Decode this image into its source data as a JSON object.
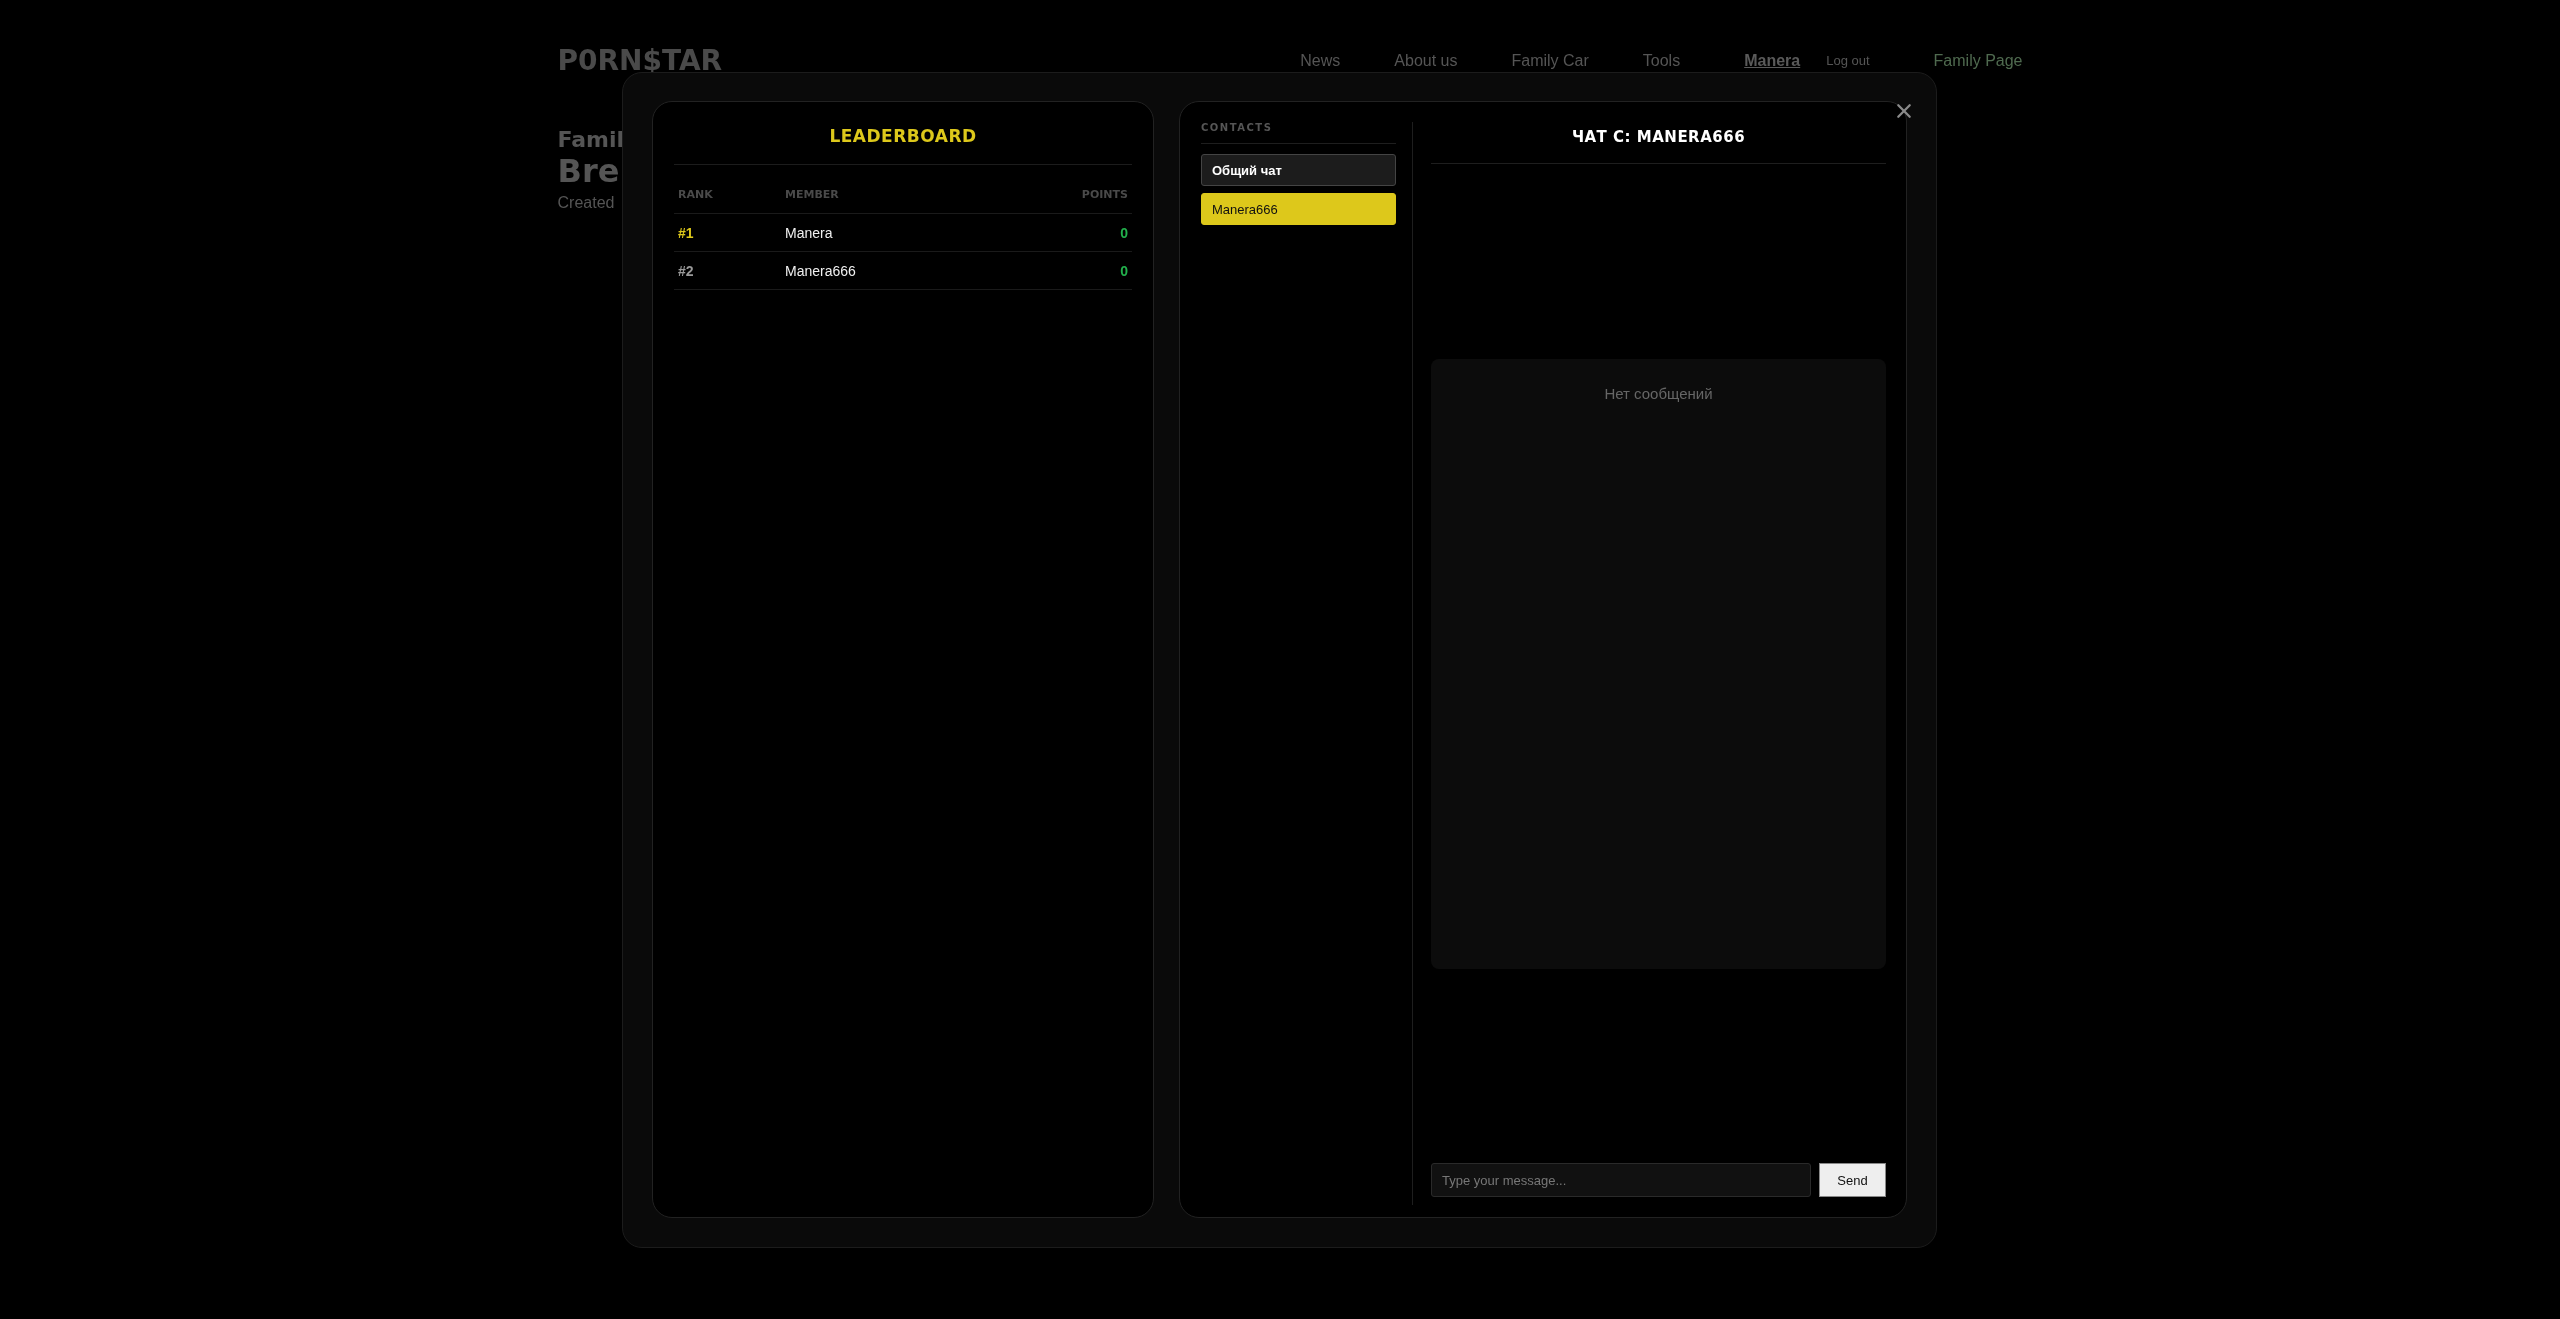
{
  "site": {
    "logo": "P0RN$TAR",
    "nav": [
      {
        "label": "News",
        "kind": "link"
      },
      {
        "label": "About us",
        "kind": "link"
      },
      {
        "label": "Family Car",
        "kind": "link"
      },
      {
        "label": "Tools",
        "kind": "link"
      },
      {
        "label": "Manera",
        "kind": "user"
      },
      {
        "label": "Log out",
        "kind": "small"
      },
      {
        "label": "Family Page",
        "kind": "button"
      }
    ]
  },
  "hero": {
    "title": "Famil",
    "subtitle": "Bre",
    "meta": "Created"
  },
  "leaderboard": {
    "title": "LEADERBOARD",
    "columns": [
      "RANK",
      "MEMBER",
      "POINTS"
    ],
    "rows": [
      {
        "rank": "#1",
        "member": "Manera",
        "points": "0",
        "top": true
      },
      {
        "rank": "#2",
        "member": "Manera666",
        "points": "0",
        "top": false
      }
    ]
  },
  "chat": {
    "contacts_label": "CONTACTS",
    "contacts": [
      {
        "name": "Общий чат",
        "selected": false
      },
      {
        "name": "Manera666",
        "selected": true
      }
    ],
    "title": "ЧАТ С: MANERA666",
    "empty_text": "Нет сообщений",
    "input": {
      "placeholder": "Type your message..."
    },
    "send": "Send"
  }
}
